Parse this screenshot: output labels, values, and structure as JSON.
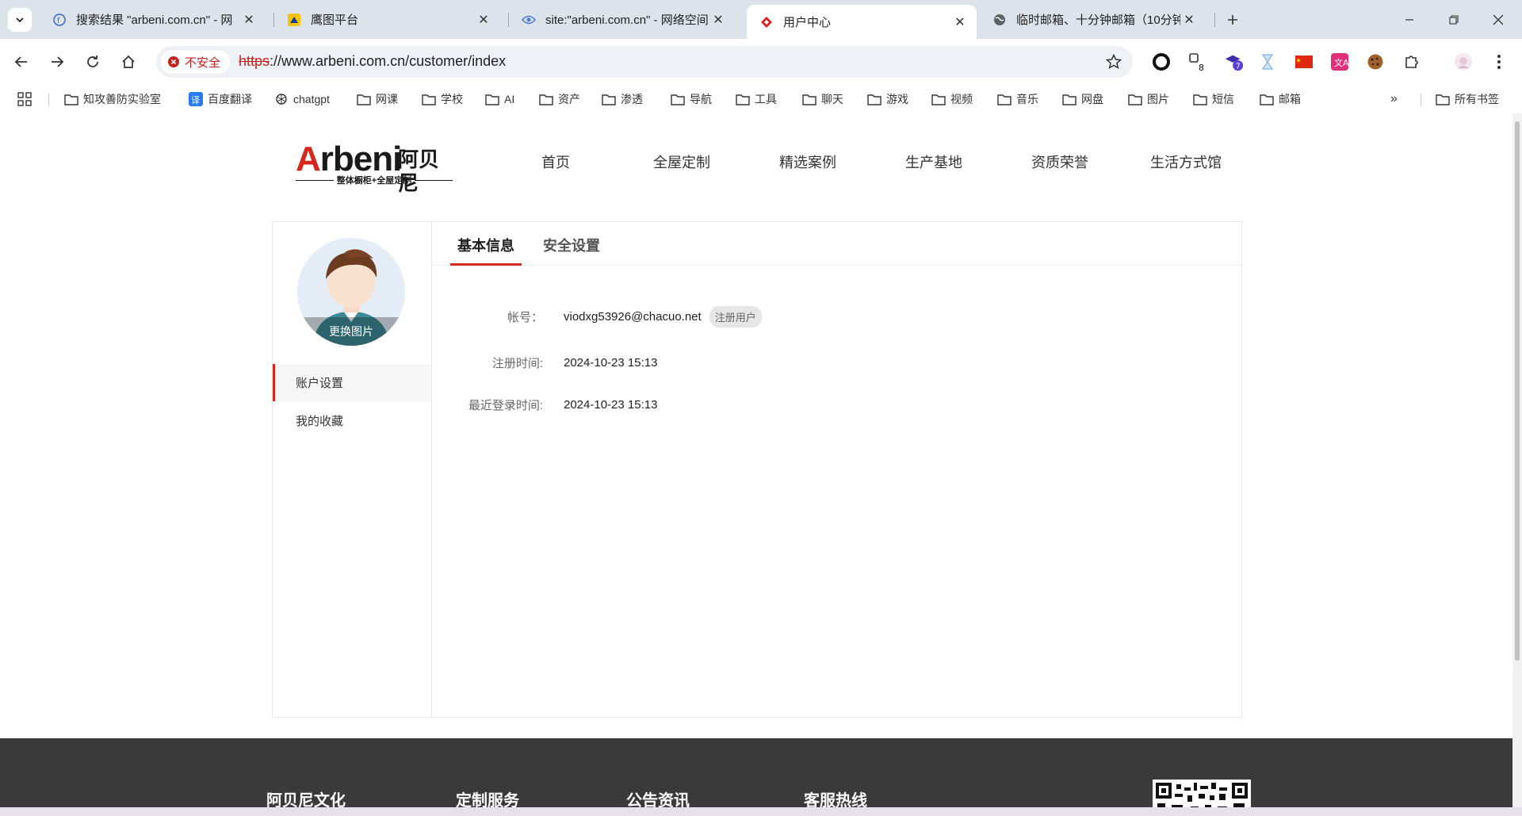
{
  "browser": {
    "tabs": [
      {
        "title": "搜索结果 \"arbeni.com.cn\" - 网",
        "active": false
      },
      {
        "title": "鹰图平台",
        "active": false
      },
      {
        "title": "site:\"arbeni.com.cn\" - 网络空间",
        "active": false
      },
      {
        "title": "用户中心",
        "active": true
      },
      {
        "title": "临时邮箱、十分钟邮箱（10分钟",
        "active": false
      }
    ],
    "security_label": "不安全",
    "url_scheme": "https",
    "url_rest": "://www.arbeni.com.cn/customer/index",
    "ext_badges": {
      "second": "8",
      "third": "7"
    },
    "bookmarks": [
      {
        "label": "知攻善防实验室",
        "icon": "folder-icon"
      },
      {
        "label": "百度翻译",
        "icon": "translate-icon"
      },
      {
        "label": "chatgpt",
        "icon": "openai-icon"
      },
      {
        "label": "网课",
        "icon": "folder-icon"
      },
      {
        "label": "学校",
        "icon": "folder-icon"
      },
      {
        "label": "AI",
        "icon": "folder-icon"
      },
      {
        "label": "资产",
        "icon": "folder-icon"
      },
      {
        "label": "渗透",
        "icon": "folder-icon"
      },
      {
        "label": "导航",
        "icon": "folder-icon"
      },
      {
        "label": "工具",
        "icon": "folder-icon"
      },
      {
        "label": "聊天",
        "icon": "folder-icon"
      },
      {
        "label": "游戏",
        "icon": "folder-icon"
      },
      {
        "label": "视频",
        "icon": "folder-icon"
      },
      {
        "label": "音乐",
        "icon": "folder-icon"
      },
      {
        "label": "网盘",
        "icon": "folder-icon"
      },
      {
        "label": "图片",
        "icon": "folder-icon"
      },
      {
        "label": "短信",
        "icon": "folder-icon"
      },
      {
        "label": "邮箱",
        "icon": "folder-icon"
      }
    ],
    "all_bookmarks": "所有书签"
  },
  "site": {
    "logo": {
      "letter_a": "A",
      "word_rest": "rbeni",
      "cn": "阿贝尼",
      "tagline": "整体橱柜+全屋定制"
    },
    "nav": [
      "首页",
      "全屋定制",
      "精选案例",
      "生产基地",
      "资质荣誉",
      "生活方式馆"
    ],
    "avatar_label": "更换图片",
    "sidebar": [
      "账户设置",
      "我的收藏"
    ],
    "tabs": [
      "基本信息",
      "安全设置"
    ],
    "info": {
      "account_label": "帐号：",
      "account_value": "viodxg53926@chacuo.net",
      "account_badge": "注册用户",
      "reg_label": "注册时间:",
      "reg_value": "2024-10-23 15:13",
      "login_label": "最近登录时间:",
      "login_value": "2024-10-23 15:13"
    },
    "footer": [
      "阿贝尼文化",
      "定制服务",
      "公告资讯",
      "客服热线"
    ]
  },
  "colors": {
    "brand_red": "#d7261d",
    "footer_bg": "#3a3a3a",
    "tabstrip_bg": "#dde3ea"
  }
}
